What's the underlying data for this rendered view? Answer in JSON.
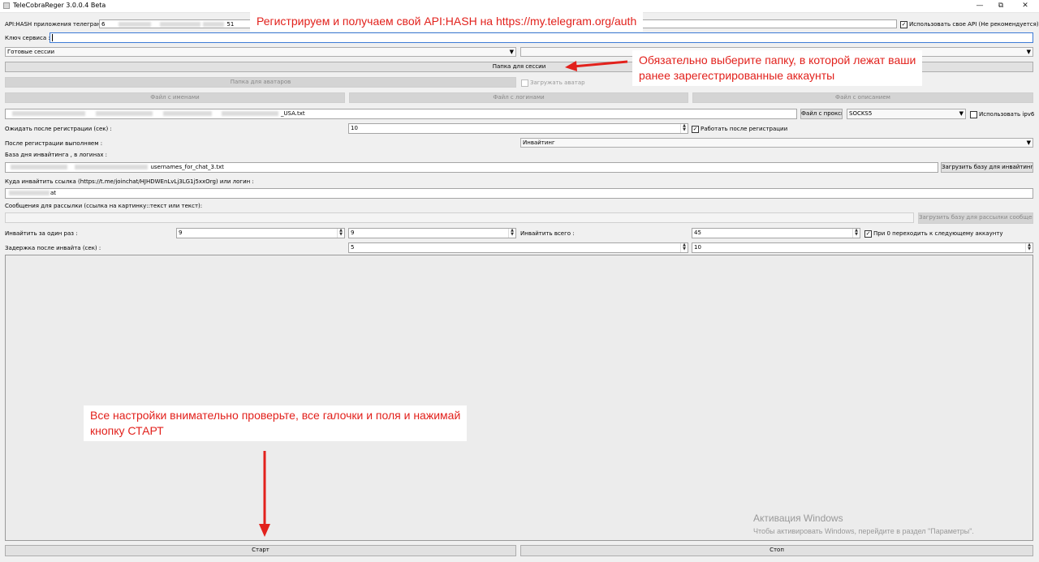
{
  "window": {
    "title": "TeleCobraReger 3.0.0.4 Beta",
    "controls": [
      "—",
      "⧉",
      "✕"
    ]
  },
  "api_hash": {
    "label": "API:HASH приложения телегран :",
    "value_start": "6",
    "value_end": "51",
    "checkbox_label": "Использовать свое API (Не рекомендуется)",
    "checked": true
  },
  "service_key": {
    "label": "Ключ сервиса :",
    "value": ""
  },
  "sessions": {
    "selected": "Готовые сессии",
    "second_selected": "",
    "folder_button": "Папка для сессии"
  },
  "avatars": {
    "folder_button": "Папка для аватаров",
    "upload_checkbox": "Загружать аватар",
    "checked": false
  },
  "files": {
    "names_button": "Файл с именами",
    "logins_button": "Файл с логинами",
    "description_button": "Файл с описанием"
  },
  "proxy": {
    "file_value": "_USA.txt",
    "file_button": "Файл с прокси",
    "type": "SOCKS5",
    "ipv6_label": "Использовать ipv6",
    "ipv6_checked": false
  },
  "wait_after_registration": {
    "label": "Ожидать после регистрации (сек) :",
    "value": "10",
    "work_checkbox": "Работать после регистрации",
    "work_checked": true
  },
  "after_registration": {
    "label": "После регистрации выполняем :",
    "action": "Инвайтинг"
  },
  "invite_base": {
    "label": "База дня инвайтинга , в логинах :",
    "value": "usernames_for_chat_3.txt",
    "load_button": "Загрузить базу для инвайтинга"
  },
  "invite_target": {
    "label": "Куда инвайтить ссылка (https://t.me/joinchat/HJHDWEnLvLj3LG1j5xxOrg) или логин :",
    "value": "at"
  },
  "mailing": {
    "label": "Сообщения для рассылки (ссылка на картинку::текст или текст):",
    "value": "",
    "load_button": "Загрузить базу для рассылки сообщени"
  },
  "invite_once": {
    "label": "Инвайтить за один раз :",
    "from": "9",
    "to": "9",
    "total_label": "Инвайтить всего :",
    "total": "45",
    "next_account_checkbox": "При 0 переходить к следующему аккаунту",
    "next_account_checked": true
  },
  "invite_delay": {
    "label": "Задержка после инвайта (сек) :",
    "from": "5",
    "to": "10"
  },
  "actions": {
    "start": "Старт",
    "stop": "Стоп"
  },
  "annotations": {
    "api_hash_note": "Регистрируем и получаем свой API:HASH на https://my.telegram.org/auth",
    "folder_note_line1": "Обязательно выберите папку, в которой лежат ваши",
    "folder_note_line2": "ранее зарегестрированные аккаунты",
    "start_note_line1": "Все настройки внимательно проверьте, все галочки и поля и нажимай",
    "start_note_line2": "кнопку СТАРТ"
  },
  "watermark": {
    "title": "Активация Windows",
    "subtitle": "Чтобы активировать Windows, перейдите в раздел \"Параметры\"."
  },
  "colors": {
    "annotation": "#e2211c",
    "focus_border": "#3d7bd6"
  }
}
